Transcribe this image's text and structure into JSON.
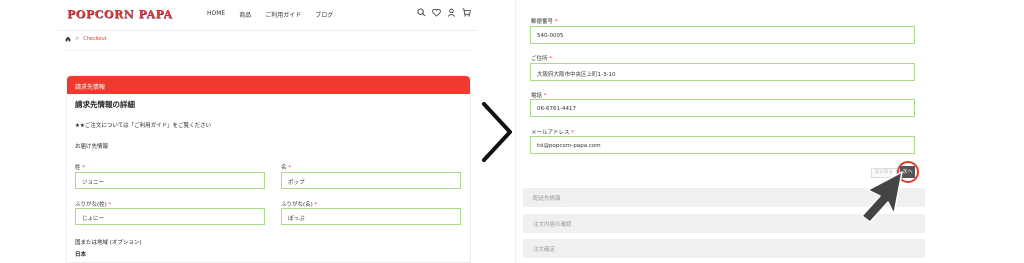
{
  "header": {
    "logo": "POPCORN PAPA",
    "nav": [
      "HOME",
      "商品",
      "ご利用ガイド",
      "ブログ"
    ]
  },
  "breadcrumb": {
    "current": "Checkout"
  },
  "billing": {
    "section_header": "請求先情報",
    "title": "請求先情報の詳細",
    "note": "★★ご注文については「ご利用ガイド」をご覧ください",
    "sub": "お届け先情報",
    "last_name_label": "姓",
    "last_name_value": "ジョニー",
    "first_name_label": "名",
    "first_name_value": "ポップ",
    "last_kana_label": "ふりがな(姓)",
    "last_kana_value": "じょにー",
    "first_kana_label": "ふりがな(名)",
    "first_kana_value": "ぽっぷ",
    "country_label": "国または地域 (オプション)",
    "country_value": "日本"
  },
  "right_form": {
    "postal_label": "郵便番号",
    "postal_value": "540-0005",
    "address_label": "ご住所",
    "address_value": "大阪府大阪市中央区上町1-3-10",
    "phone_label": "電話",
    "phone_value": "06-6761-4417",
    "email_label": "メールアドレス",
    "email_value": "tsi@popcorn-papa.com",
    "back_label": "前に戻る",
    "next_label": "次へ",
    "steps": [
      "配送先情報",
      "注文内容の確認",
      "注文確定"
    ]
  },
  "required_mark": "*",
  "colors": {
    "accent": "#f0392f",
    "field_border": "#a9dc8a"
  }
}
